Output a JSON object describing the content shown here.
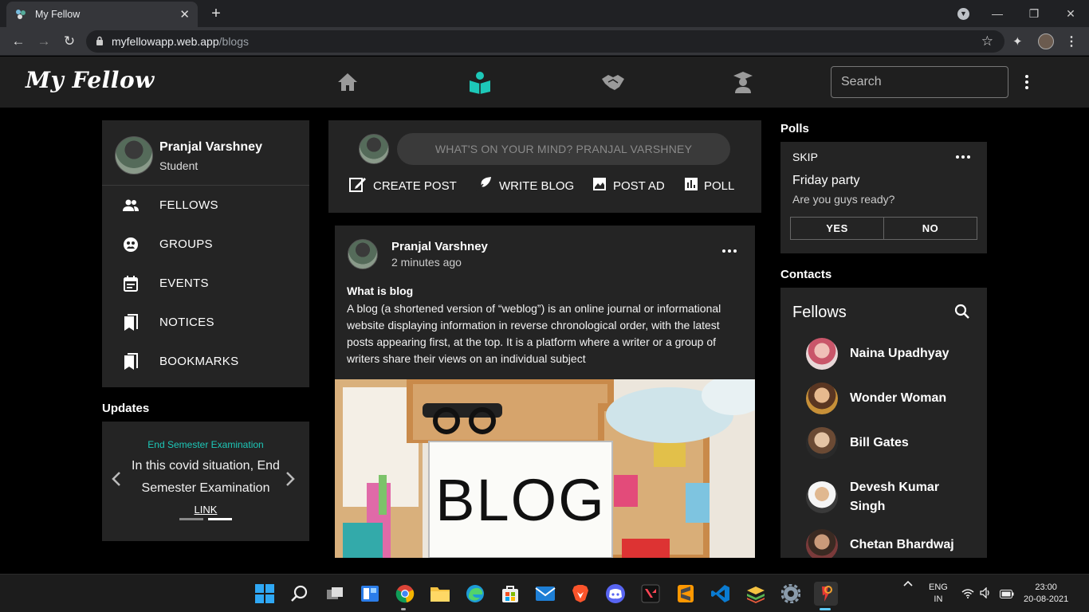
{
  "browser": {
    "tab_title": "My Fellow",
    "url_host": "myfellowapp.web.app",
    "url_path": "/blogs"
  },
  "app": {
    "logo": "My Fellow",
    "search_placeholder": "Search",
    "accent_color": "#1dc8b8"
  },
  "profile": {
    "name": "Pranjal Varshney",
    "role": "Student",
    "menu": [
      {
        "label": "FELLOWS",
        "icon": "people-icon"
      },
      {
        "label": "GROUPS",
        "icon": "groups-icon"
      },
      {
        "label": "EVENTS",
        "icon": "calendar-icon"
      },
      {
        "label": "NOTICES",
        "icon": "notice-icon"
      },
      {
        "label": "BOOKMARKS",
        "icon": "bookmark-icon"
      }
    ]
  },
  "updates": {
    "label": "Updates",
    "title": "End Semester Examination",
    "text": "In this covid situation, End Semester Examination",
    "link": "LINK"
  },
  "composer": {
    "placeholder": "WHAT'S ON YOUR MIND? PRANJAL VARSHNEY",
    "actions": [
      "CREATE POST",
      "WRITE BLOG",
      "POST AD",
      "POLL"
    ]
  },
  "post": {
    "author": "Pranjal Varshney",
    "time": "2 minutes ago",
    "title": "What is blog",
    "body": "A blog (a shortened version of “weblog”) is an online journal or informational website displaying information in reverse chronological order, with the latest posts appearing first, at the top. It is a platform where a writer or a group of writers share their views on an individual subject",
    "image_text": "BLOG"
  },
  "polls": {
    "label": "Polls",
    "skip": "SKIP",
    "question": "Friday party",
    "subtitle": "Are you guys ready?",
    "options": [
      "YES",
      "NO"
    ]
  },
  "contacts": {
    "label": "Contacts",
    "heading": "Fellows",
    "list": [
      "Naina Upadhyay",
      "Wonder Woman",
      "Bill Gates",
      "Devesh Kumar Singh",
      "Chetan Bhardwaj"
    ]
  },
  "taskbar": {
    "lang_line1": "ENG",
    "lang_line2": "IN",
    "time": "23:00",
    "date": "20-08-2021"
  }
}
